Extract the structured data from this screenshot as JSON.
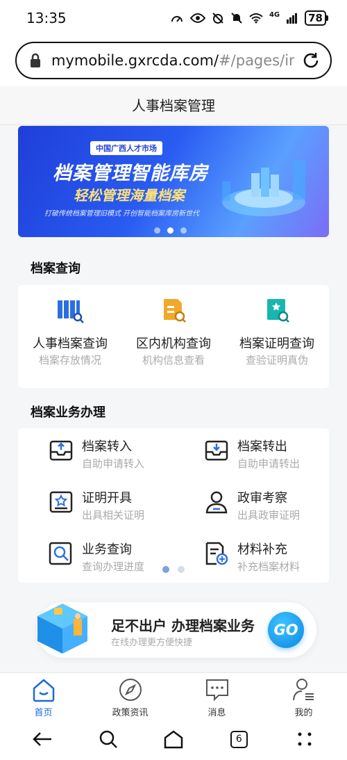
{
  "status_bar": {
    "time": "13:35",
    "battery": "78",
    "network": "4G"
  },
  "browser": {
    "url_main": "mymobile.gxrcda.com/",
    "url_dim": "#/pages/inde"
  },
  "page": {
    "title": "人事档案管理"
  },
  "banner": {
    "tag": "中国广西人才市场",
    "title": "档案管理智能库房",
    "subtitle": "轻松管理海量档案",
    "caption": "打破传统档案管理旧模式  开创智能档案库房新世代",
    "slide_index": 2,
    "slide_count": 3
  },
  "query_section": {
    "title": "档案查询",
    "items": [
      {
        "label": "人事档案查询",
        "sub": "档案存放情况",
        "icon": "file-search-icon"
      },
      {
        "label": "区内机构查询",
        "sub": "机构信息查看",
        "icon": "building-search-icon"
      },
      {
        "label": "档案证明查询",
        "sub": "查验证明真伪",
        "icon": "certificate-search-icon"
      }
    ]
  },
  "business_section": {
    "title": "档案业务办理",
    "items": [
      {
        "label": "档案转入",
        "sub": "自助申请转入",
        "icon": "inbox-in-icon"
      },
      {
        "label": "档案转出",
        "sub": "自助申请转出",
        "icon": "inbox-out-icon"
      },
      {
        "label": "证明开具",
        "sub": "出具相关证明",
        "icon": "certificate-icon"
      },
      {
        "label": "政审考察",
        "sub": "出具政审证明",
        "icon": "person-icon"
      },
      {
        "label": "业务查询",
        "sub": "查询办理进度",
        "icon": "magnifier-icon"
      },
      {
        "label": "材料补充",
        "sub": "补充档案材料",
        "icon": "document-add-icon"
      }
    ],
    "page_index": 1,
    "page_count": 2
  },
  "promo": {
    "title": "足不出户 办理档案业务",
    "subtitle": "在线办理更方便快捷",
    "button": "GO"
  },
  "tabbar": {
    "items": [
      {
        "label": "首页",
        "icon": "home-icon",
        "active": true
      },
      {
        "label": "政策资讯",
        "icon": "compass-icon",
        "active": false
      },
      {
        "label": "消息",
        "icon": "message-icon",
        "active": false
      },
      {
        "label": "我的",
        "icon": "profile-icon",
        "active": false
      }
    ]
  },
  "system_nav": {
    "tab_count": "6"
  },
  "colors": {
    "accent": "#1a6ad8",
    "banner_blue": "#2343d6",
    "go_blue": "#0a86e6",
    "icon_orange": "#f0a92a",
    "icon_teal": "#19b6b0"
  }
}
